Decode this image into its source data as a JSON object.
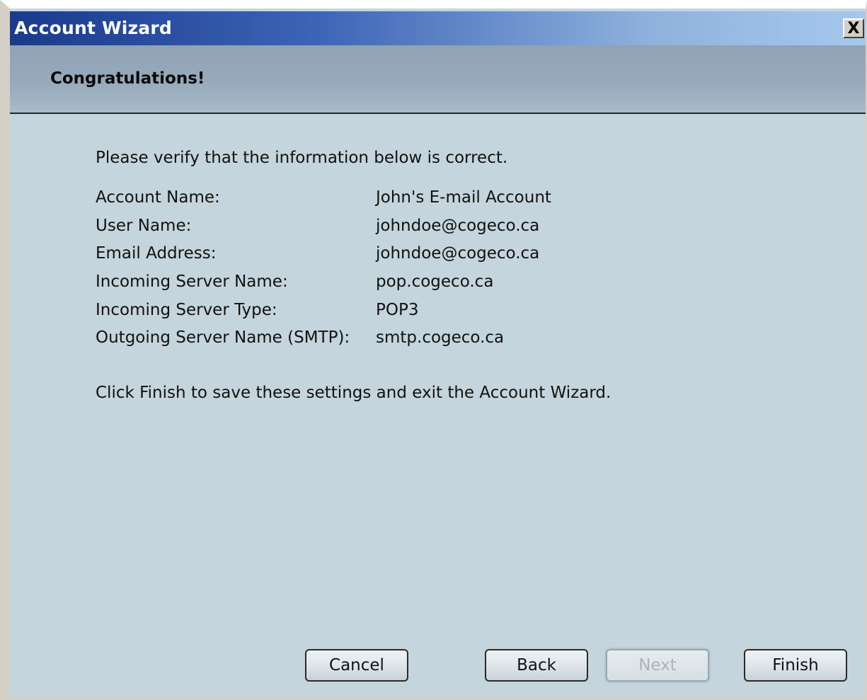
{
  "window": {
    "title": "Account Wizard",
    "close_glyph": "X"
  },
  "header": {
    "heading": "Congratulations!"
  },
  "content": {
    "intro": "Please verify that the information below is correct.",
    "rows": [
      {
        "label": "Account Name:",
        "value": "John's  E-mail Account"
      },
      {
        "label": "User Name:",
        "value": "johndoe@cogeco.ca"
      },
      {
        "label": "Email Address:",
        "value": "johndoe@cogeco.ca"
      },
      {
        "label": "Incoming Server Name:",
        "value": "pop.cogeco.ca"
      },
      {
        "label": "Incoming Server Type:",
        "value": "POP3"
      },
      {
        "label": "Outgoing Server Name (SMTP):",
        "value": "smtp.cogeco.ca"
      }
    ],
    "outro": "Click Finish to save these settings and exit the Account Wizard."
  },
  "buttons": {
    "cancel": "Cancel",
    "back": "Back",
    "next": "Next",
    "finish": "Finish"
  },
  "colors": {
    "body_background": "#c5d5dd",
    "title_gradient_start": "#1a3a8c",
    "title_gradient_end": "#a6c8ef",
    "header_background": "#97aabb",
    "disabled_text": "#aab4bb"
  }
}
